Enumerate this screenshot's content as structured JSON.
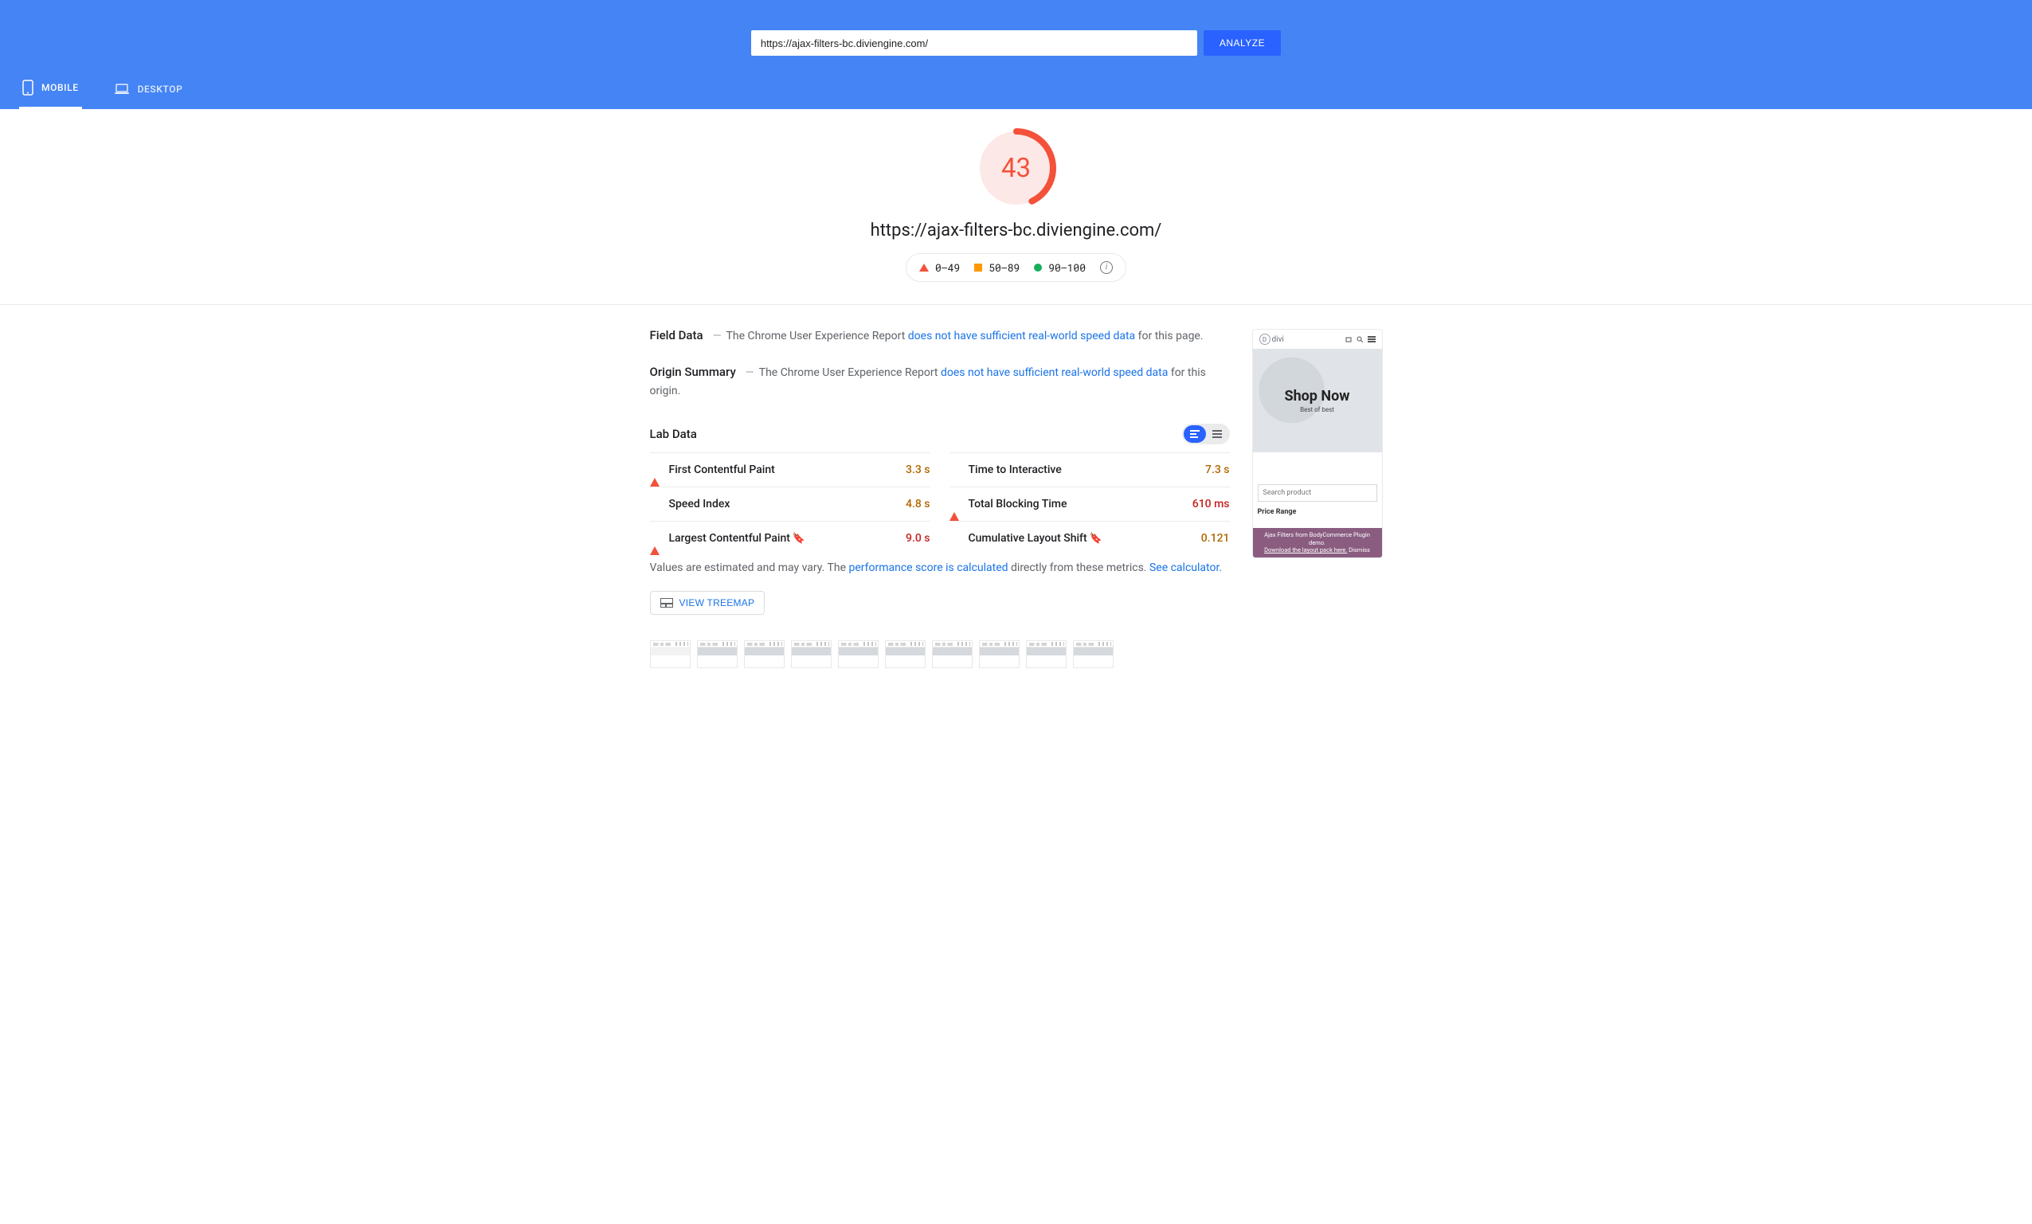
{
  "header": {
    "url_value": "https://ajax-filters-bc.diviengine.com/",
    "analyze_label": "ANALYZE",
    "tabs": {
      "mobile": "MOBILE",
      "desktop": "DESKTOP"
    }
  },
  "score": {
    "value": "43",
    "percent": 43,
    "url": "https://ajax-filters-bc.diviengine.com/",
    "legend": {
      "poor": "0–49",
      "mid": "50–89",
      "good": "90–100"
    }
  },
  "field_data": {
    "title": "Field Data",
    "prefix": "The Chrome User Experience Report ",
    "link": "does not have sufficient real-world speed data",
    "suffix": " for this page."
  },
  "origin_summary": {
    "title": "Origin Summary",
    "prefix": "The Chrome User Experience Report ",
    "link": "does not have sufficient real-world speed data",
    "suffix": " for this origin."
  },
  "lab": {
    "title": "Lab Data",
    "left": [
      {
        "shape": "tri",
        "name": "First Contentful Paint",
        "value": "3.3 s",
        "cls": "val-orange",
        "bookmark": false
      },
      {
        "shape": "sq",
        "name": "Speed Index",
        "value": "4.8 s",
        "cls": "val-orange",
        "bookmark": false
      },
      {
        "shape": "tri",
        "name": "Largest Contentful Paint",
        "value": "9.0 s",
        "cls": "val-red",
        "bookmark": true
      }
    ],
    "right": [
      {
        "shape": "sq",
        "name": "Time to Interactive",
        "value": "7.3 s",
        "cls": "val-orange",
        "bookmark": false
      },
      {
        "shape": "tri",
        "name": "Total Blocking Time",
        "value": "610 ms",
        "cls": "val-red",
        "bookmark": false
      },
      {
        "shape": "sq",
        "name": "Cumulative Layout Shift",
        "value": "0.121",
        "cls": "val-orange",
        "bookmark": true
      }
    ]
  },
  "footnote": {
    "p1": "Values are estimated and may vary. The ",
    "link1": "performance score is calculated",
    "p2": " directly from these metrics. ",
    "link2": "See calculator.",
    "treemap": "VIEW TREEMAP"
  },
  "preview": {
    "logo": "divi",
    "shop": "Shop Now",
    "best": "Best of best",
    "search_ph": "Search product",
    "price_label": "Price Range",
    "banner_l1": "Ajax Filters from BodyCommerce Plugin demo.",
    "banner_l2a": "Download the layout pack here.",
    "banner_l2b": " Dismiss"
  }
}
